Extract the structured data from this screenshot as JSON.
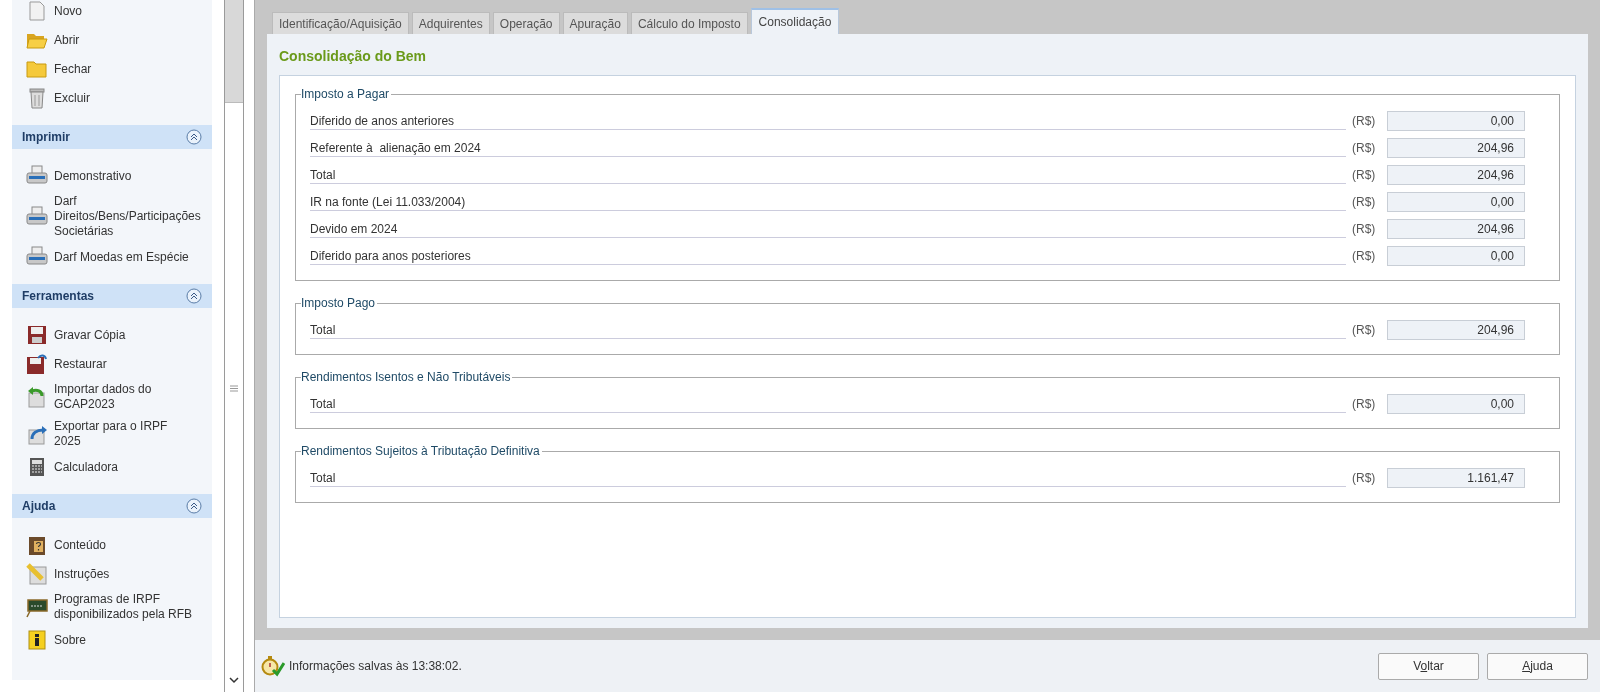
{
  "sidebar": {
    "sections": [
      {
        "items": [
          {
            "label": "Novo"
          },
          {
            "label": "Abrir"
          },
          {
            "label": "Fechar"
          },
          {
            "label": "Excluir"
          }
        ]
      },
      {
        "title": "Imprimir",
        "expanded": true,
        "items": [
          {
            "label": "Demonstrativo"
          },
          {
            "label": "Darf Direitos/Bens/Participações Societárias"
          },
          {
            "label": "Darf Moedas em Espécie"
          }
        ]
      },
      {
        "title": "Ferramentas",
        "expanded": true,
        "items": [
          {
            "label": "Gravar Cópia"
          },
          {
            "label": "Restaurar"
          },
          {
            "label": "Importar dados do GCAP2023"
          },
          {
            "label": "Exportar para o IRPF 2025"
          },
          {
            "label": "Calculadora"
          }
        ]
      },
      {
        "title": "Ajuda",
        "expanded": true,
        "items": [
          {
            "label": "Conteúdo"
          },
          {
            "label": "Instruções"
          },
          {
            "label": "Programas de IRPF disponibilizados pela RFB"
          },
          {
            "label": "Sobre"
          }
        ]
      }
    ]
  },
  "tabs": [
    {
      "label": "Identificação/Aquisição",
      "selected": false
    },
    {
      "label": "Adquirentes",
      "selected": false
    },
    {
      "label": "Operação",
      "selected": false
    },
    {
      "label": "Apuração",
      "selected": false
    },
    {
      "label": "Cálculo do Imposto",
      "selected": false
    },
    {
      "label": "Consolidação",
      "selected": true
    }
  ],
  "panel": {
    "title": "Consolidação do Bem",
    "groups": [
      {
        "title": "Imposto a Pagar",
        "rows": [
          {
            "label": "Diferido de anos anteriores",
            "unit": "(R$)",
            "value": "0,00"
          },
          {
            "label": "Referente à  alienação em 2024",
            "unit": "(R$)",
            "value": "204,96"
          },
          {
            "label": "Total",
            "unit": "(R$)",
            "value": "204,96"
          },
          {
            "label": "IR na fonte (Lei 11.033/2004)",
            "unit": "(R$)",
            "value": "0,00"
          },
          {
            "label": "Devido em 2024",
            "unit": "(R$)",
            "value": "204,96"
          },
          {
            "label": "Diferido para anos posteriores",
            "unit": "(R$)",
            "value": "0,00"
          }
        ]
      },
      {
        "title": "Imposto Pago",
        "rows": [
          {
            "label": "Total",
            "unit": "(R$)",
            "value": "204,96"
          }
        ]
      },
      {
        "title": "Rendimentos Isentos e Não Tributáveis",
        "rows": [
          {
            "label": "Total",
            "unit": "(R$)",
            "value": "0,00"
          }
        ]
      },
      {
        "title": "Rendimentos Sujeitos à Tributação Definitiva",
        "rows": [
          {
            "label": "Total",
            "unit": "(R$)",
            "value": "1.161,47"
          }
        ]
      }
    ]
  },
  "status_bar": {
    "message": "Informações salvas às 13:38:02."
  },
  "buttons": [
    {
      "before": "V",
      "mnemonic": "o",
      "after": "ltar"
    },
    {
      "mnemonic": "A",
      "after": "juda"
    }
  ]
}
